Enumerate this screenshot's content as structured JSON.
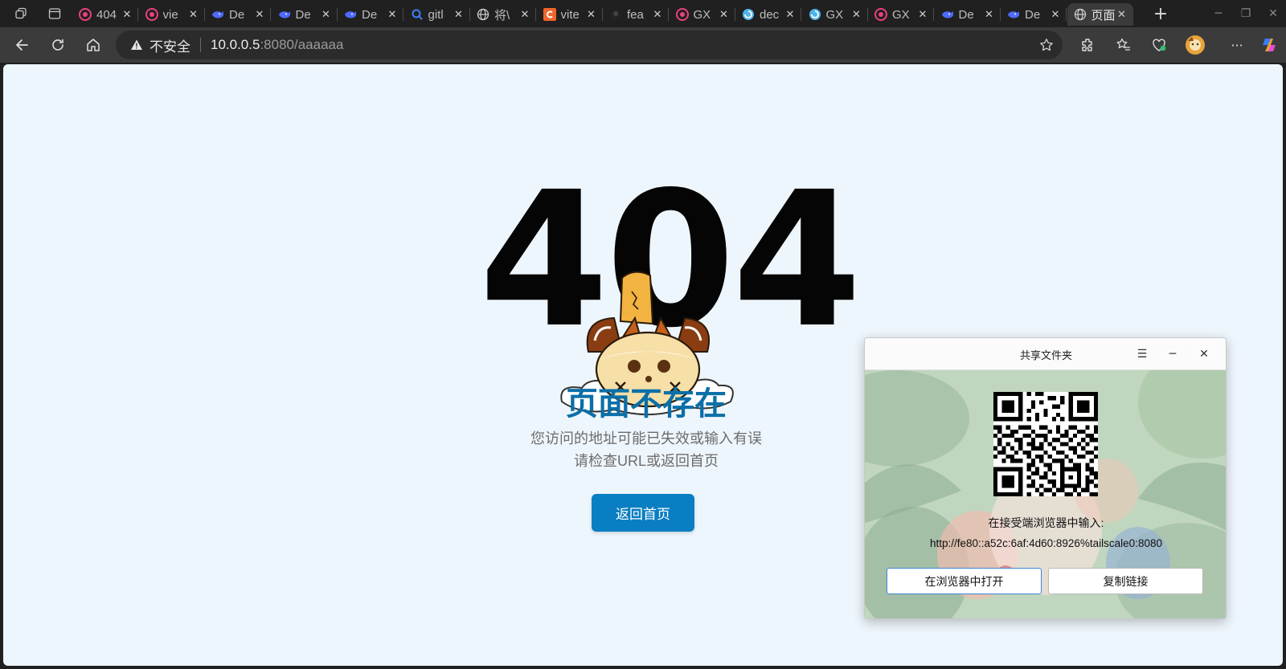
{
  "browser": {
    "tabs": [
      {
        "title": "404",
        "icon": "circle-logo-icon",
        "color": "#e8417f"
      },
      {
        "title": "vie",
        "icon": "circle-logo-icon",
        "color": "#e8417f"
      },
      {
        "title": "De",
        "icon": "whale-logo-icon",
        "color": "#4d6bfe"
      },
      {
        "title": "De",
        "icon": "whale-logo-icon",
        "color": "#4d6bfe"
      },
      {
        "title": "De",
        "icon": "whale-logo-icon",
        "color": "#4d6bfe"
      },
      {
        "title": "gitl",
        "icon": "search-icon",
        "color": "#3b82f6"
      },
      {
        "title": "将\\",
        "icon": "globe-icon",
        "color": "#cfcfcf"
      },
      {
        "title": "vite",
        "icon": "c-logo-icon",
        "color": "#f0652a"
      },
      {
        "title": "fea",
        "icon": "github-icon",
        "color": "#222222"
      },
      {
        "title": "GX",
        "icon": "circle-logo-icon",
        "color": "#e8417f"
      },
      {
        "title": "dec",
        "icon": "spiral-logo-icon",
        "color": "#4fb3e8"
      },
      {
        "title": "GX",
        "icon": "spiral-logo-icon",
        "color": "#4fb3e8"
      },
      {
        "title": "GX",
        "icon": "circle-logo-icon",
        "color": "#e8417f"
      },
      {
        "title": "De",
        "icon": "whale-logo-icon",
        "color": "#4d6bfe"
      },
      {
        "title": "De",
        "icon": "whale-logo-icon",
        "color": "#4d6bfe"
      },
      {
        "title": "页面",
        "icon": "globe-icon",
        "color": "#cfcfcf",
        "active": true
      }
    ],
    "address": {
      "security_label": "不安全",
      "url_host": "10.0.0.5",
      "url_rest": ":8080/aaaaaa"
    }
  },
  "page": {
    "error_code": "404",
    "title": "页面不存在",
    "desc_line1": "您访问的地址可能已失效或输入有误",
    "desc_line2": "请检查URL或返回首页",
    "home_button": "返回首页",
    "colors": {
      "title": "#0b6fa8",
      "button": "#0a7ec2",
      "background": "#eef6fd"
    }
  },
  "share_dialog": {
    "title": "共享文件夹",
    "label": "在接受端浏览器中输入:",
    "url": "http://fe80::a52c:6af:4d60:8926%tailscale0:8080",
    "open_button": "在浏览器中打开",
    "copy_button": "复制链接"
  }
}
